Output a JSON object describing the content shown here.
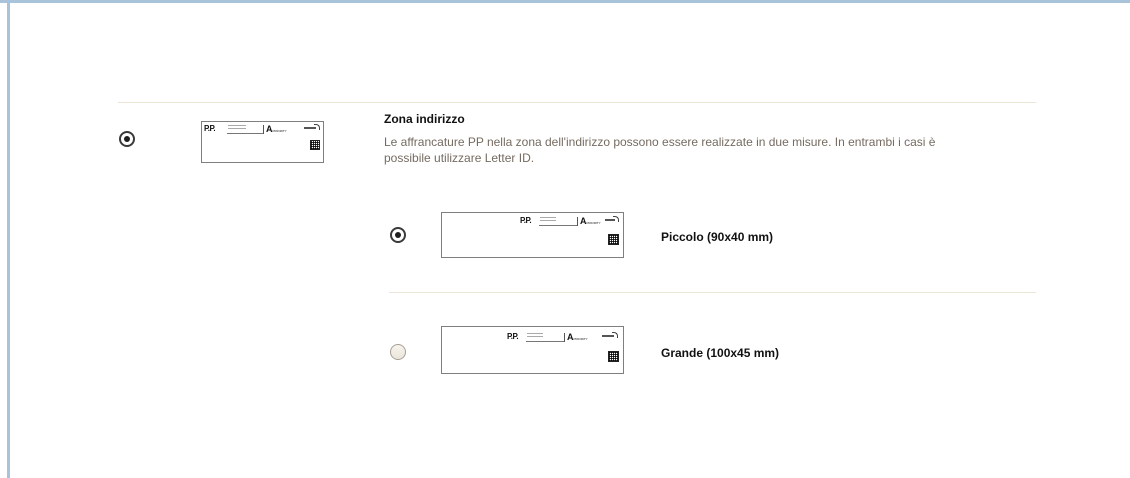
{
  "section": {
    "title": "Zona indirizzo",
    "description": "Le affrancature PP nella zona dell'indirizzo possono essere realizzate in due misure. In entrambi i casi è possibile utilizzare Letter ID.",
    "selected": true
  },
  "stamp_preview": {
    "pp_text": "P.P.",
    "a_text": "A",
    "a_small_text": "PRIORITY"
  },
  "options": [
    {
      "label": "Piccolo (90x40 mm)",
      "selected": true
    },
    {
      "label": "Grande (100x45 mm)",
      "selected": false
    }
  ],
  "colors": {
    "frame_border": "#a9c4da",
    "divider": "#ece5d6",
    "description_text": "#756b60",
    "title_text": "#111111"
  }
}
